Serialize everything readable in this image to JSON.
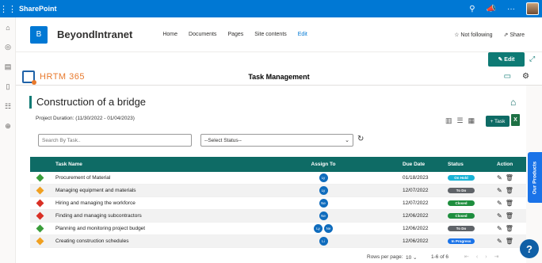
{
  "suitebar": {
    "app_name": "SharePoint"
  },
  "site": {
    "logo_letter": "B",
    "name": "BeyondIntranet",
    "nav": [
      "Home",
      "Documents",
      "Pages",
      "Site contents",
      "Edit"
    ],
    "follow_label": "Not following",
    "share_label": "Share"
  },
  "command": {
    "edit_label": "Edit"
  },
  "app": {
    "logo_text": "HRTM 365",
    "title": "Task Management"
  },
  "project": {
    "title": "Construction of a bridge",
    "duration": "Project Duration:  (11/30/2022 - 01/04/2023)",
    "add_task_label": "+ Task"
  },
  "filters": {
    "search_placeholder": "Search By Task..",
    "status_selected": "--Select Status--"
  },
  "table": {
    "headers": {
      "name": "Task Name",
      "assign": "Assign To",
      "due": "Due Date",
      "status": "Status",
      "action": "Action"
    },
    "rows": [
      {
        "priority_color": "#3a9d3a",
        "name": "Procurement of Material",
        "assignees": [
          "Ly"
        ],
        "due": "01/18/2023",
        "status": "On Hold",
        "status_color": "#17b3d6"
      },
      {
        "priority_color": "#f0a020",
        "name": "Managing equipment and materials",
        "assignees": [
          "Ly"
        ],
        "due": "12/07/2022",
        "status": "To Do",
        "status_color": "#5f6368"
      },
      {
        "priority_color": "#d93025",
        "name": "Hiring and managing the workforce",
        "assignees": [
          "Ne"
        ],
        "due": "12/07/2022",
        "status": "Closed",
        "status_color": "#1e8e3e"
      },
      {
        "priority_color": "#d93025",
        "name": "Finding and managing subcontractors",
        "assignees": [
          "Ne"
        ],
        "due": "12/06/2022",
        "status": "Closed",
        "status_color": "#1e8e3e"
      },
      {
        "priority_color": "#3a9d3a",
        "name": "Planning and monitoring project budget",
        "assignees": [
          "Ly",
          "Ne"
        ],
        "due": "12/06/2022",
        "status": "To Do",
        "status_color": "#5f6368"
      },
      {
        "priority_color": "#f0a020",
        "name": "Creating construction schedules",
        "assignees": [
          "Li"
        ],
        "due": "12/06/2022",
        "status": "In Progress",
        "status_color": "#1a73e8"
      }
    ]
  },
  "pagination": {
    "rows_label": "Rows per page:",
    "rows_value": "10",
    "range": "1-6 of 6"
  },
  "side": {
    "our_products": "Our Products",
    "help": "?"
  }
}
